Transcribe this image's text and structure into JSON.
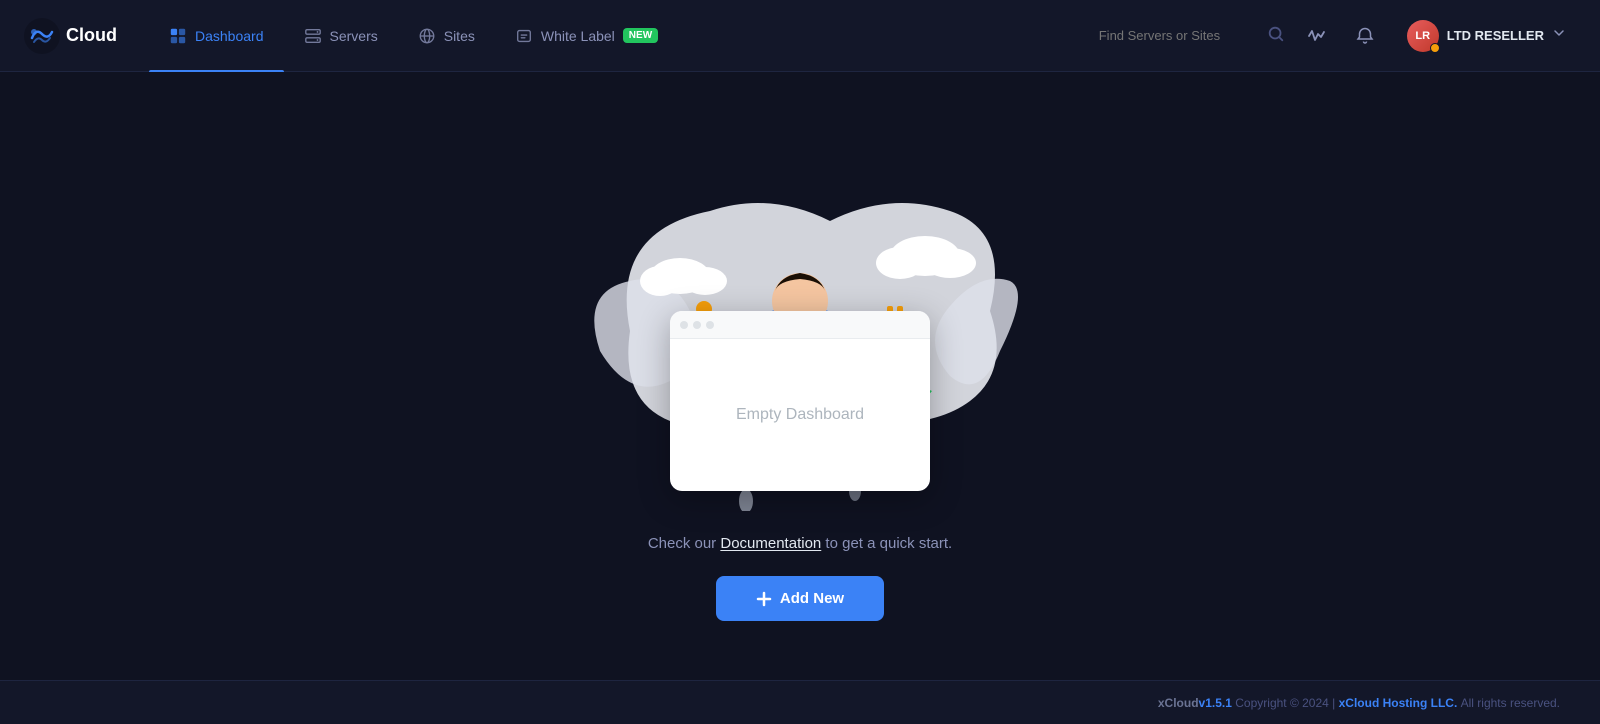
{
  "app": {
    "logo_text": "Cloud",
    "logo_icon": "xcloud"
  },
  "nav": {
    "items": [
      {
        "id": "dashboard",
        "label": "Dashboard",
        "active": true,
        "icon": "dashboard-icon"
      },
      {
        "id": "servers",
        "label": "Servers",
        "active": false,
        "icon": "servers-icon"
      },
      {
        "id": "sites",
        "label": "Sites",
        "active": false,
        "icon": "globe-icon"
      },
      {
        "id": "white-label",
        "label": "White Label",
        "active": false,
        "icon": "white-label-icon",
        "badge": "New"
      }
    ]
  },
  "search": {
    "placeholder": "Find Servers or Sites"
  },
  "user": {
    "initials": "LR",
    "display_name": "LTD RESELLER",
    "avatar_bg": "#c0392b"
  },
  "main": {
    "empty_dashboard_label": "Empty Dashboard",
    "cta_text_before": "Check our ",
    "cta_link_text": "Documentation",
    "cta_text_after": " to get a quick start.",
    "add_new_label": "+ Add New",
    "add_new_icon": "plus-icon"
  },
  "footer": {
    "brand": "xCloud",
    "version": "v1.5.1",
    "copyright": "Copyright © 2024 |",
    "company": "xCloud Hosting LLC.",
    "rights": "All rights reserved."
  },
  "screen_card": {
    "dots": [
      "dot1",
      "dot2",
      "dot3"
    ]
  }
}
